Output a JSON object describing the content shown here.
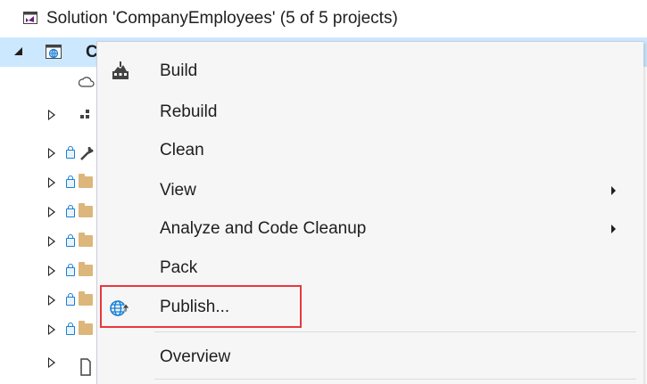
{
  "solution": {
    "label": "Solution 'CompanyEmployees' (5 of 5 projects)"
  },
  "project": {
    "label": "C"
  },
  "context_menu": {
    "items": [
      {
        "label": "Build",
        "icon": "build-icon",
        "submenu": false
      },
      {
        "label": "Rebuild",
        "icon": "",
        "submenu": false
      },
      {
        "label": "Clean",
        "icon": "",
        "submenu": false
      },
      {
        "label": "View",
        "icon": "",
        "submenu": true
      },
      {
        "label": "Analyze and Code Cleanup",
        "icon": "",
        "submenu": true
      },
      {
        "label": "Pack",
        "icon": "",
        "submenu": false
      },
      {
        "label": "Publish...",
        "icon": "publish-globe-icon",
        "submenu": false
      },
      {
        "label": "Overview",
        "icon": "",
        "submenu": false
      }
    ]
  },
  "colors": {
    "selection": "#cce8ff",
    "menu_bg": "#f6f6f6",
    "highlight_border": "#e8383d",
    "lock": "#1a7fd4",
    "folder": "#dcb67a"
  }
}
